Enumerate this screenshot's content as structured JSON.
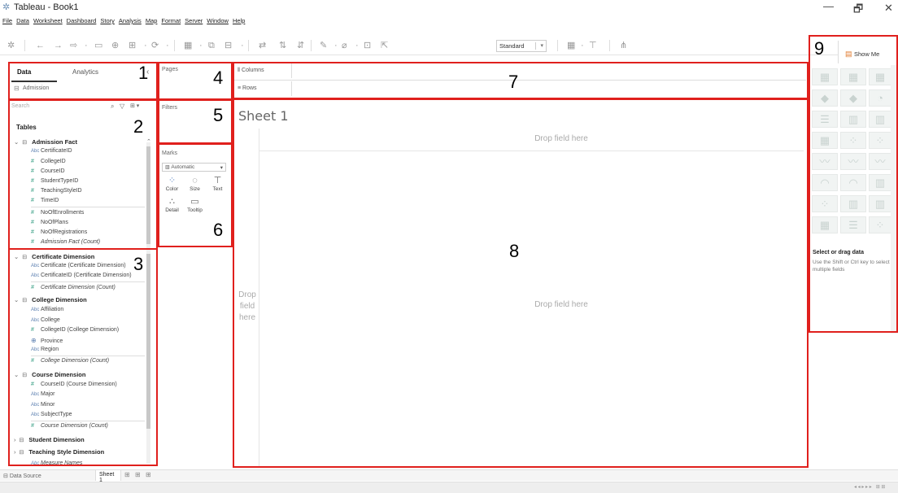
{
  "window": {
    "title": "Tableau - Book1",
    "minimize": "—",
    "maximize": "🗗",
    "close": "✕"
  },
  "menu": [
    "File",
    "Data",
    "Worksheet",
    "Dashboard",
    "Story",
    "Analysis",
    "Map",
    "Format",
    "Server",
    "Window",
    "Help"
  ],
  "toolbar": {
    "fit": "Standard"
  },
  "data_pane": {
    "tabs": [
      "Data",
      "Analytics"
    ],
    "datasource": "Admission",
    "search_placeholder": "Search",
    "tables_label": "Tables"
  },
  "tables": {
    "admission_fact": {
      "name": "Admission Fact",
      "fields": [
        {
          "type": "Abc",
          "name": "CertificateID"
        },
        {
          "type": "#",
          "name": "CollegeID"
        },
        {
          "type": "#",
          "name": "CourseID"
        },
        {
          "type": "#",
          "name": "StudentTypeID"
        },
        {
          "type": "#",
          "name": "TeachingStyleID"
        },
        {
          "type": "#",
          "name": "TimeID"
        },
        {
          "type": "#",
          "name": "NoOfEnrollments"
        },
        {
          "type": "#",
          "name": "NoOfPlans"
        },
        {
          "type": "#",
          "name": "NoOfRegistrations"
        },
        {
          "type": "#",
          "name": "Admission Fact (Count)"
        }
      ]
    },
    "certificate_dimension": {
      "name": "Certificate Dimension",
      "fields": [
        {
          "type": "Abc",
          "name": "Certificate (Certificate Dimension)"
        },
        {
          "type": "Abc",
          "name": "CertificateID (Certificate Dimension)"
        },
        {
          "type": "#",
          "name": "Certificate Dimension (Count)"
        }
      ]
    },
    "college_dimension": {
      "name": "College Dimension",
      "fields": [
        {
          "type": "Abc",
          "name": "Affiliation"
        },
        {
          "type": "Abc",
          "name": "College"
        },
        {
          "type": "#",
          "name": "CollegeID (College Dimension)"
        },
        {
          "type": "geo",
          "name": "Province"
        },
        {
          "type": "Abc",
          "name": "Region"
        },
        {
          "type": "#",
          "name": "College Dimension (Count)"
        }
      ]
    },
    "course_dimension": {
      "name": "Course Dimension",
      "fields": [
        {
          "type": "#",
          "name": "CourseID (Course Dimension)"
        },
        {
          "type": "Abc",
          "name": "Major"
        },
        {
          "type": "Abc",
          "name": "Minor"
        },
        {
          "type": "Abc",
          "name": "SubjectType"
        },
        {
          "type": "#",
          "name": "Course Dimension (Count)"
        }
      ]
    },
    "student_dimension": {
      "name": "Student Dimension"
    },
    "teaching_style_dimension": {
      "name": "Teaching Style Dimension"
    },
    "measure_names": "Measure Names"
  },
  "cards": {
    "pages": "Pages",
    "filters": "Filters",
    "marks": "Marks",
    "marks_type": "Automatic",
    "mark_buttons": [
      "Color",
      "Size",
      "Text",
      "Detail",
      "Tooltip"
    ]
  },
  "shelves": {
    "columns": "Columns",
    "rows": "Rows"
  },
  "canvas": {
    "sheet_title": "Sheet 1",
    "drop_top": "Drop field here",
    "drop_left": "Drop field here",
    "drop_center": "Drop field here"
  },
  "show_me": {
    "label": "Show Me",
    "title": "Select or drag data",
    "hint": "Use the Shift or Ctrl key to select multiple fields"
  },
  "bottom": {
    "datasource_tab": "Data Source",
    "sheet_tab": "Sheet 1"
  },
  "annotations": {
    "n1": "1",
    "n2": "2",
    "n3": "3",
    "n4": "4",
    "n5": "5",
    "n6": "6",
    "n7": "7",
    "n8": "8",
    "n9": "9"
  },
  "colors": {
    "annotation_red": "#e0201d",
    "dimension_blue": "#5b7fb0",
    "measure_green": "#2e9a7e"
  }
}
